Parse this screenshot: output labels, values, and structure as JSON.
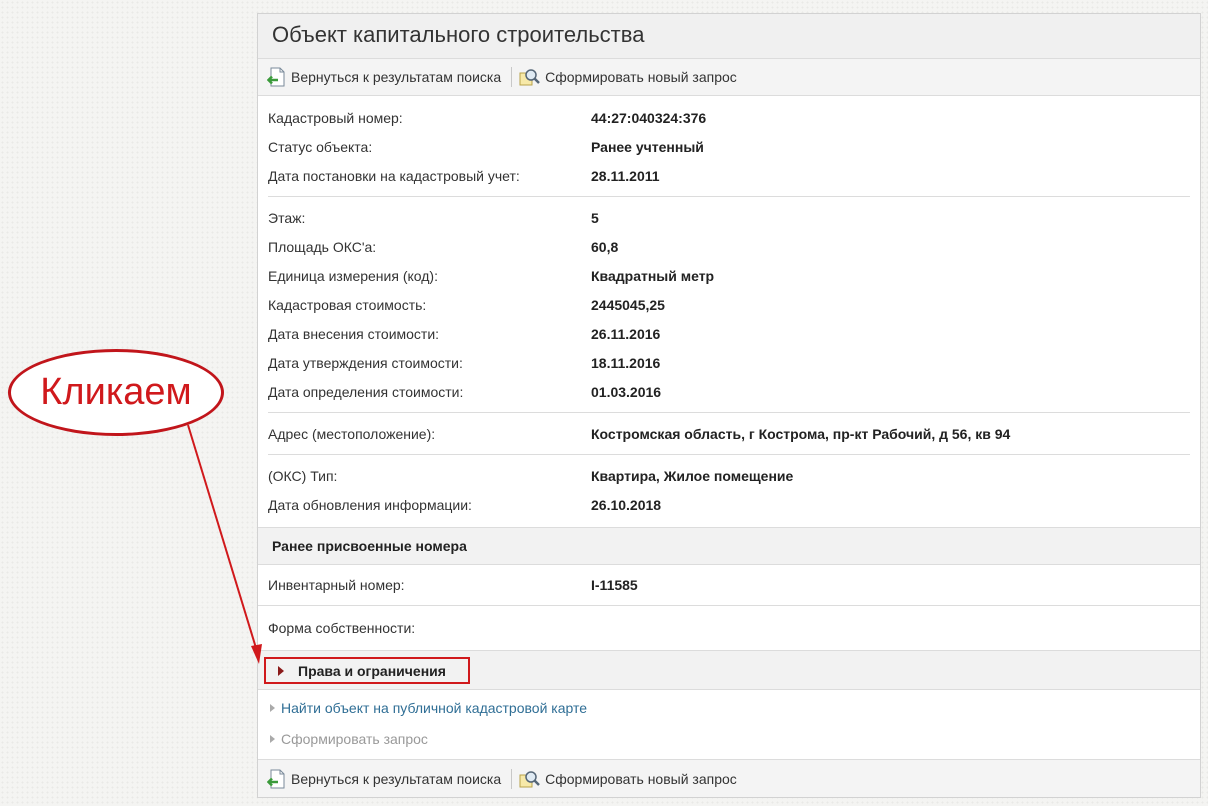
{
  "panel": {
    "title": "Объект капитального строительства"
  },
  "toolbar": {
    "back_label": "Вернуться к результатам поиска",
    "new_request_label": "Сформировать новый запрос"
  },
  "group1": [
    {
      "label": "Кадастровый номер:",
      "value": "44:27:040324:376"
    },
    {
      "label": "Статус объекта:",
      "value": "Ранее учтенный"
    },
    {
      "label": "Дата постановки на кадастровый учет:",
      "value": "28.11.2011"
    }
  ],
  "group2": [
    {
      "label": "Этаж:",
      "value": "5"
    },
    {
      "label": "Площадь ОКС'а:",
      "value": "60,8"
    },
    {
      "label": "Единица измерения (код):",
      "value": "Квадратный метр"
    },
    {
      "label": "Кадастровая стоимость:",
      "value": "2445045,25"
    },
    {
      "label": "Дата внесения стоимости:",
      "value": "26.11.2016"
    },
    {
      "label": "Дата утверждения стоимости:",
      "value": "18.11.2016"
    },
    {
      "label": "Дата определения стоимости:",
      "value": "01.03.2016"
    }
  ],
  "group3": [
    {
      "label": "Адрес (местоположение):",
      "value": "Костромская область, г Кострома, пр-кт Рабочий, д 56, кв 94"
    }
  ],
  "group4": [
    {
      "label": "(ОКС) Тип:",
      "value": "Квартира, Жилое помещение"
    },
    {
      "label": "Дата обновления информации:",
      "value": "26.10.2018"
    }
  ],
  "previous_numbers": {
    "heading": "Ранее присвоенные номера",
    "label": "Инвентарный номер:",
    "value": "I-11585"
  },
  "ownership": {
    "label": "Форма собственности:"
  },
  "rights": {
    "label": "Права и ограничения"
  },
  "links": {
    "public_map": "Найти объект на публичной кадастровой карте",
    "make_request": "Сформировать запрос"
  },
  "annotation": {
    "callout_text": "Кликаем",
    "color": "#d0191c"
  }
}
